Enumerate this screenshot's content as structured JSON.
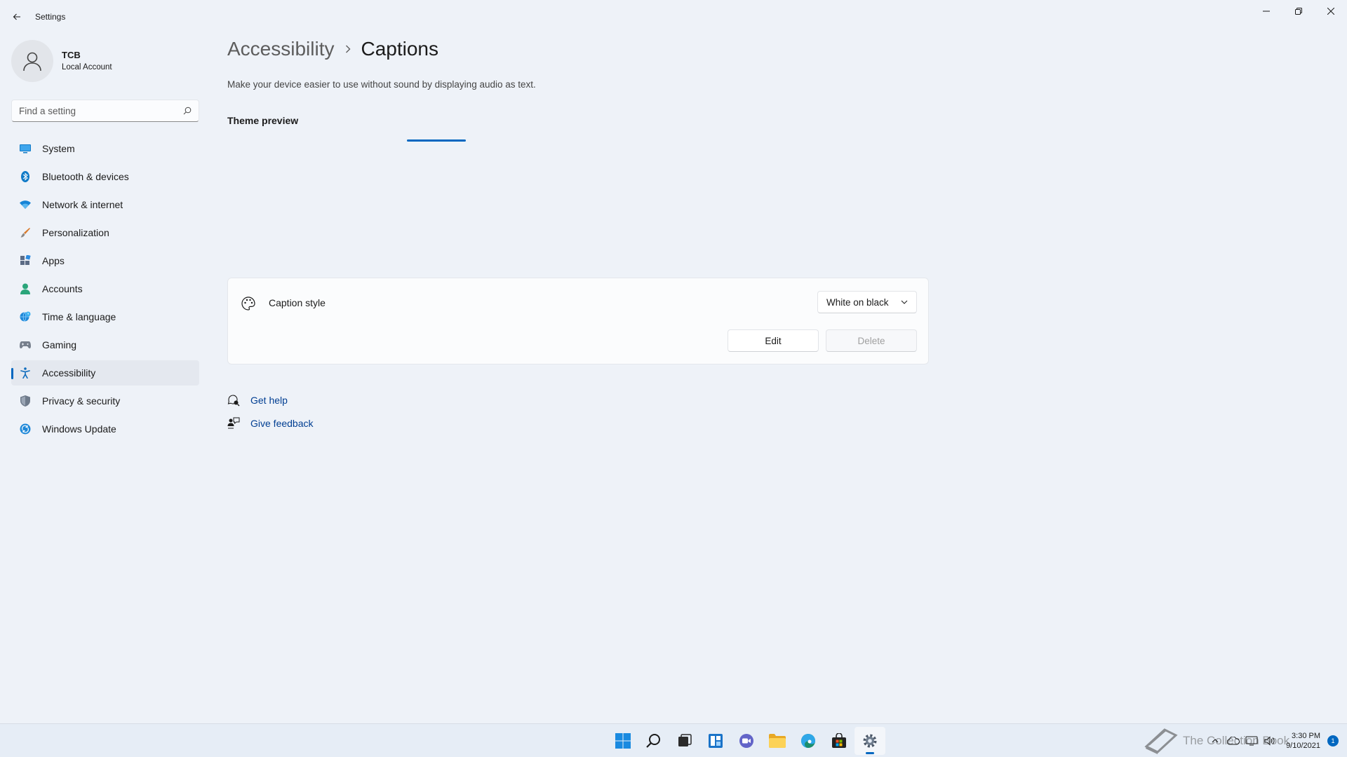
{
  "window": {
    "title": "Settings"
  },
  "profile": {
    "name": "TCB",
    "account_type": "Local Account"
  },
  "search": {
    "placeholder": "Find a setting"
  },
  "sidebar": {
    "items": [
      {
        "label": "System",
        "icon": "system-icon"
      },
      {
        "label": "Bluetooth & devices",
        "icon": "bluetooth-icon"
      },
      {
        "label": "Network & internet",
        "icon": "wifi-icon"
      },
      {
        "label": "Personalization",
        "icon": "brush-icon"
      },
      {
        "label": "Apps",
        "icon": "apps-icon"
      },
      {
        "label": "Accounts",
        "icon": "accounts-icon"
      },
      {
        "label": "Time & language",
        "icon": "globe-clock-icon"
      },
      {
        "label": "Gaming",
        "icon": "gamepad-icon"
      },
      {
        "label": "Accessibility",
        "icon": "accessibility-icon",
        "active": true
      },
      {
        "label": "Privacy & security",
        "icon": "shield-icon"
      },
      {
        "label": "Windows Update",
        "icon": "update-icon"
      }
    ]
  },
  "breadcrumb": {
    "parent": "Accessibility",
    "current": "Captions"
  },
  "page": {
    "description": "Make your device easier to use without sound by displaying audio as text.",
    "section_title": "Theme preview"
  },
  "caption_style": {
    "label": "Caption style",
    "selected": "White on black",
    "edit_label": "Edit",
    "delete_label": "Delete"
  },
  "links": {
    "help": "Get help",
    "feedback": "Give feedback"
  },
  "taskbar": {
    "apps": [
      "start-icon",
      "search-icon",
      "task-view-icon",
      "widgets-icon",
      "chat-icon",
      "file-explorer-icon",
      "edge-icon",
      "store-icon",
      "settings-icon"
    ],
    "time": "3:30 PM",
    "date": "9/10/2021",
    "notifications": "1"
  },
  "watermark": {
    "text": "The Collection Book"
  },
  "colors": {
    "accent": "#0067c0",
    "background": "#eef2f8",
    "link": "#003e92"
  }
}
